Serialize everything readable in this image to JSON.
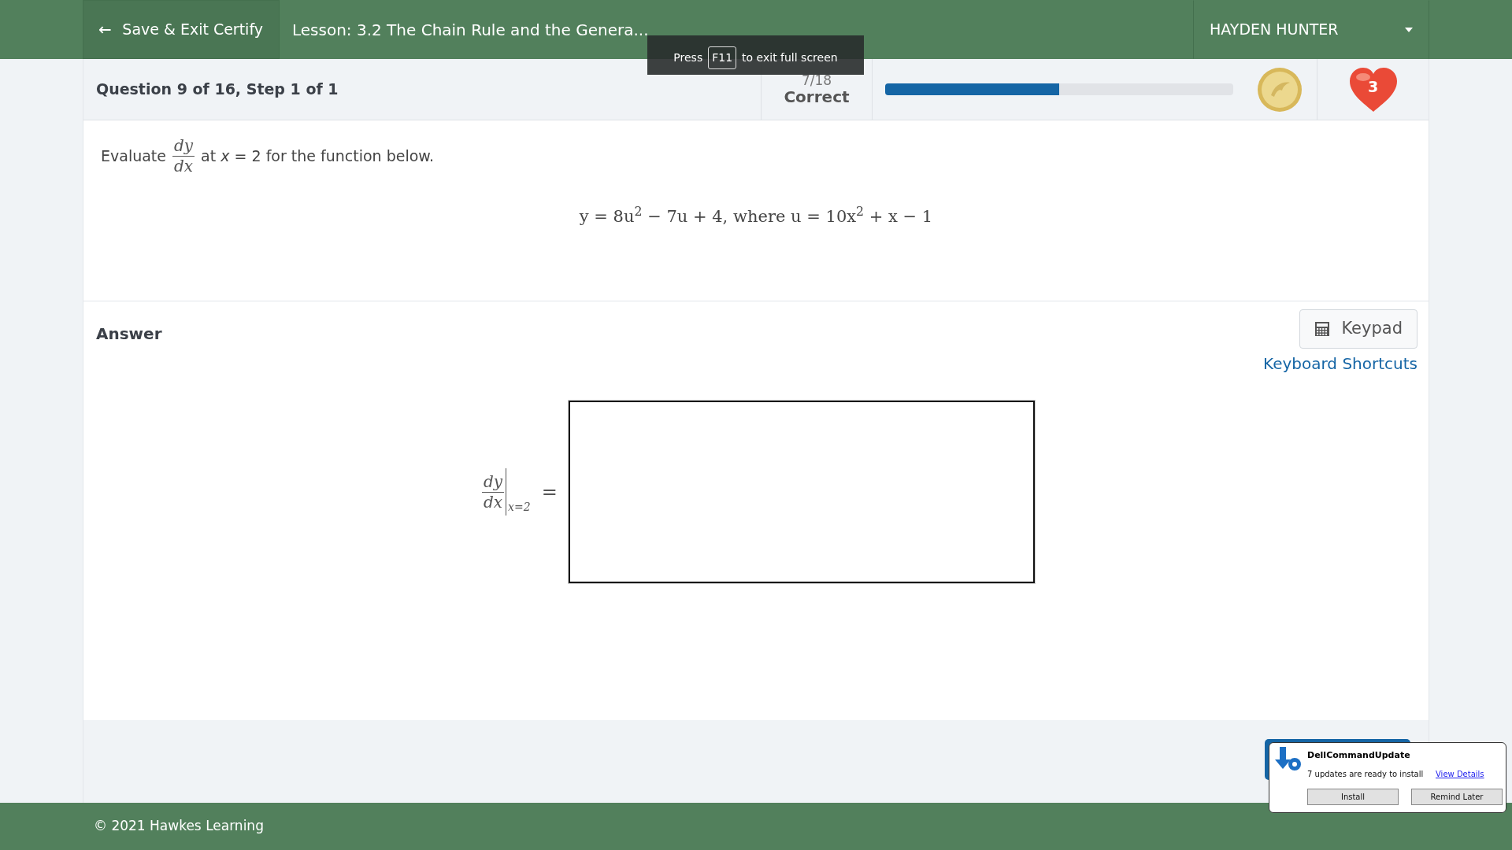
{
  "header": {
    "exit_button": "Save & Exit Certify",
    "lesson_title": "Lesson: 3.2 The Chain Rule and the Genera...",
    "user_menu": "HAYDEN HUNTER"
  },
  "status": {
    "question": "Question 9 of 16, Step 1 of 1",
    "score": "7/18",
    "score_label": "Correct",
    "progress": {
      "level": 0.5
    },
    "lives": "3"
  },
  "fullscreen_notice": {
    "before": "Press",
    "key": "F11",
    "after": "to exit full screen"
  },
  "prompt": {
    "before": "Evaluate",
    "numerator": "dy",
    "denominator": "dx",
    "after": "at *x* = 2 for the function below."
  },
  "equation": "y = 8u$^{2}$ − 7u + 4, where u = 10x$^{2}$ + x − 1",
  "answer": {
    "heading": "Answer",
    "keypad_button": "Keypad",
    "shortcuts_link": "Keyboard Shortcuts",
    "numerator": "dy",
    "denominator": "dx",
    "evaluated_at": "x=2",
    "relation": "="
  },
  "notification": {
    "app": "DellCommandUpdate",
    "message": "7 updates are ready to install",
    "link": "View Details",
    "buttons": [
      "Install",
      "Remind Later"
    ]
  },
  "footer": "© 2021 Hawkes Learning"
}
